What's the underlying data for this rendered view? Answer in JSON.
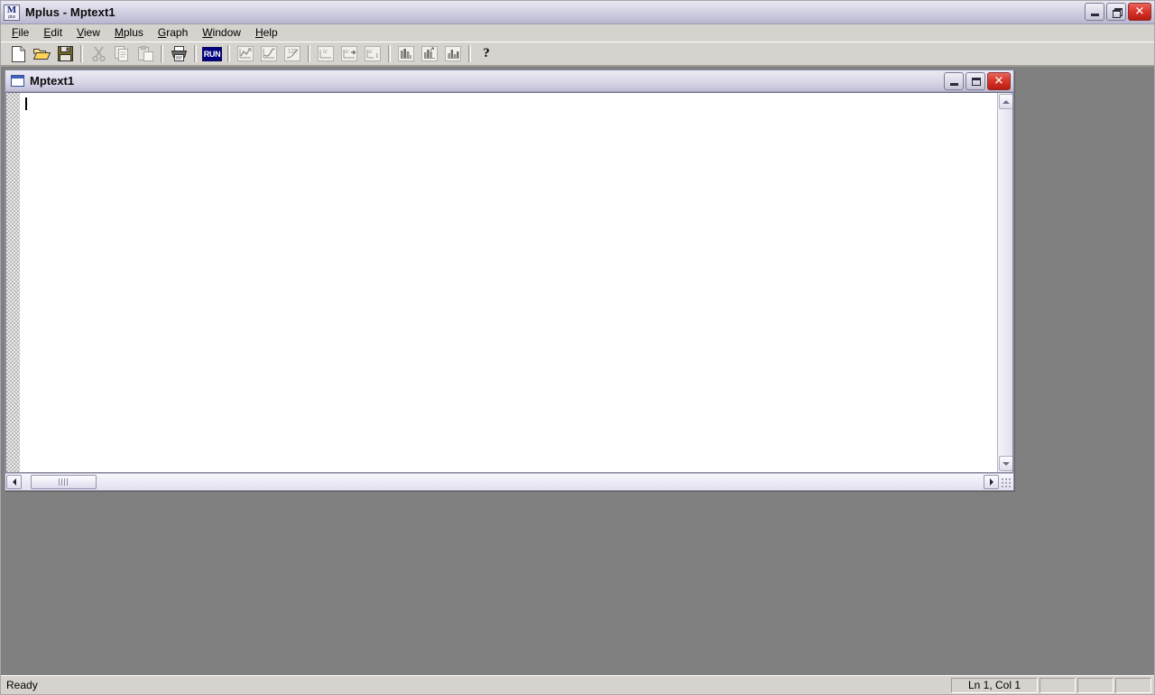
{
  "app": {
    "title": "Mplus - Mptext1",
    "icon": "mplus-app-icon",
    "icon_letter": "M",
    "icon_sub": "plus"
  },
  "title_buttons": [
    {
      "name": "minimize",
      "label": "Minimize",
      "glyph": "minimize-icon"
    },
    {
      "name": "restore",
      "label": "Restore",
      "glyph": "restore-icon"
    },
    {
      "name": "close",
      "label": "Close",
      "glyph": "✕"
    }
  ],
  "menu": {
    "items": [
      {
        "label": "File",
        "accel": "F"
      },
      {
        "label": "Edit",
        "accel": "E"
      },
      {
        "label": "View",
        "accel": "V"
      },
      {
        "label": "Mplus",
        "accel": "M"
      },
      {
        "label": "Graph",
        "accel": "G"
      },
      {
        "label": "Window",
        "accel": "W"
      },
      {
        "label": "Help",
        "accel": "H"
      }
    ]
  },
  "toolbar": {
    "buttons": [
      {
        "name": "new",
        "label": "New",
        "icon": "new-document-icon",
        "enabled": true
      },
      {
        "name": "open",
        "label": "Open",
        "icon": "open-folder-icon",
        "enabled": true
      },
      {
        "name": "save",
        "label": "Save",
        "icon": "save-floppy-icon",
        "enabled": true
      },
      {
        "name": "cut",
        "label": "Cut",
        "icon": "scissors-icon",
        "enabled": false
      },
      {
        "name": "copy",
        "label": "Copy",
        "icon": "copy-icon",
        "enabled": false
      },
      {
        "name": "paste",
        "label": "Paste",
        "icon": "paste-icon",
        "enabled": false
      },
      {
        "name": "print",
        "label": "Print",
        "icon": "printer-icon",
        "enabled": true
      },
      {
        "name": "run",
        "label": "RUN",
        "icon": "run-icon",
        "enabled": true
      },
      {
        "name": "graph-scatter",
        "label": "Graph",
        "icon": "line-graph-icon",
        "enabled": false
      },
      {
        "name": "graph-curve",
        "label": "Graph Curve",
        "icon": "curve-graph-icon",
        "enabled": false
      },
      {
        "name": "graph-123",
        "label": "Graph Series",
        "icon": "series-graph-icon",
        "enabled": false
      },
      {
        "name": "ic-plot",
        "label": "IC Plot",
        "icon": "ic-plot-icon",
        "enabled": false
      },
      {
        "name": "ic-next",
        "label": "IC Next",
        "icon": "ic-next-icon",
        "enabled": false
      },
      {
        "name": "ic-first",
        "label": "IC First",
        "icon": "ic-first-icon",
        "enabled": false
      },
      {
        "name": "histogram",
        "label": "Histogram",
        "icon": "histogram-icon",
        "enabled": false
      },
      {
        "name": "bar-chart",
        "label": "Bar Chart",
        "icon": "bar-chart-icon",
        "enabled": false
      },
      {
        "name": "column-chart",
        "label": "Column Chart",
        "icon": "column-chart-icon",
        "enabled": false
      },
      {
        "name": "help",
        "label": "Help",
        "icon": "question-mark-icon",
        "enabled": true
      }
    ],
    "run_text": "RUN",
    "help_text": "?"
  },
  "child_window": {
    "title": "Mptext1",
    "icon": "text-document-icon",
    "buttons": [
      {
        "name": "minimize",
        "label": "Minimize",
        "glyph": "minimize-icon"
      },
      {
        "name": "maximize",
        "label": "Maximize",
        "glyph": "maximize-icon"
      },
      {
        "name": "close",
        "label": "Close",
        "glyph": "✕"
      }
    ],
    "editor": {
      "content": "",
      "placeholder": ""
    }
  },
  "status_bar": {
    "message": "Ready",
    "line_col": "Ln 1, Col 1",
    "pane2": "",
    "pane3": "",
    "pane4": ""
  },
  "colors": {
    "title_gradient_start": "#e9e8f2",
    "title_gradient_end": "#b8b7cf",
    "mdi_background": "#808080",
    "face": "#d6d3ce",
    "run_button": "#000080",
    "close_button": "#d9382c",
    "editor_background": "#ffffff"
  }
}
